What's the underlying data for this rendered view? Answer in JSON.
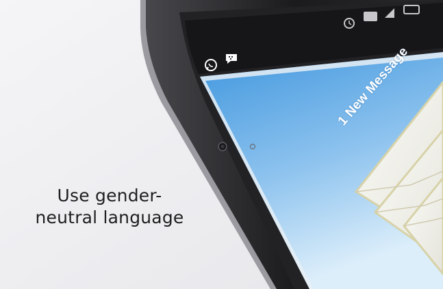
{
  "caption": {
    "line1": "Use gender-",
    "line2": "neutral language"
  },
  "phone_screen": {
    "notification_text": "1 New Message",
    "status_bar_icons": [
      "alarm-icon",
      "hd-icon",
      "signal-icon",
      "battery-icon"
    ],
    "notification_icons": [
      "whatsapp-icon",
      "blackberry-messenger-icon"
    ]
  },
  "colors": {
    "background": "#f1f1f3",
    "phone_body": "#2a2a2c",
    "screen_blue": "#4a9fe0",
    "envelope": "#f7f6ee",
    "caption_text": "#1e1e1e"
  }
}
